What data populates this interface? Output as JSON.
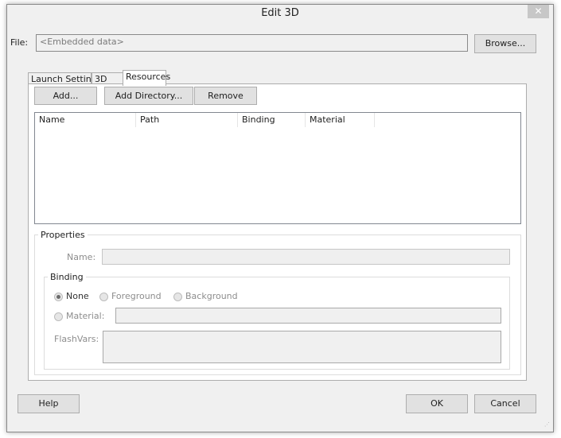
{
  "window": {
    "title": "Edit 3D",
    "close_label": "✕"
  },
  "file": {
    "label": "File:",
    "value": "<Embedded data>",
    "browse_label": "Browse..."
  },
  "tabs": [
    {
      "label": "Launch Settings"
    },
    {
      "label": "3D"
    },
    {
      "label": "Resources"
    }
  ],
  "resources": {
    "add_label": "Add...",
    "add_directory_label": "Add Directory...",
    "remove_label": "Remove",
    "columns": [
      "Name",
      "Path",
      "Binding",
      "Material"
    ]
  },
  "properties": {
    "legend": "Properties",
    "name_label": "Name:",
    "name_value": "",
    "binding": {
      "legend": "Binding",
      "none_label": "None",
      "foreground_label": "Foreground",
      "background_label": "Background",
      "material_label": "Material:",
      "material_value": "",
      "flashvars_label": "FlashVars:",
      "flashvars_value": "",
      "selected": "None"
    }
  },
  "footer": {
    "help_label": "Help",
    "ok_label": "OK",
    "cancel_label": "Cancel"
  }
}
